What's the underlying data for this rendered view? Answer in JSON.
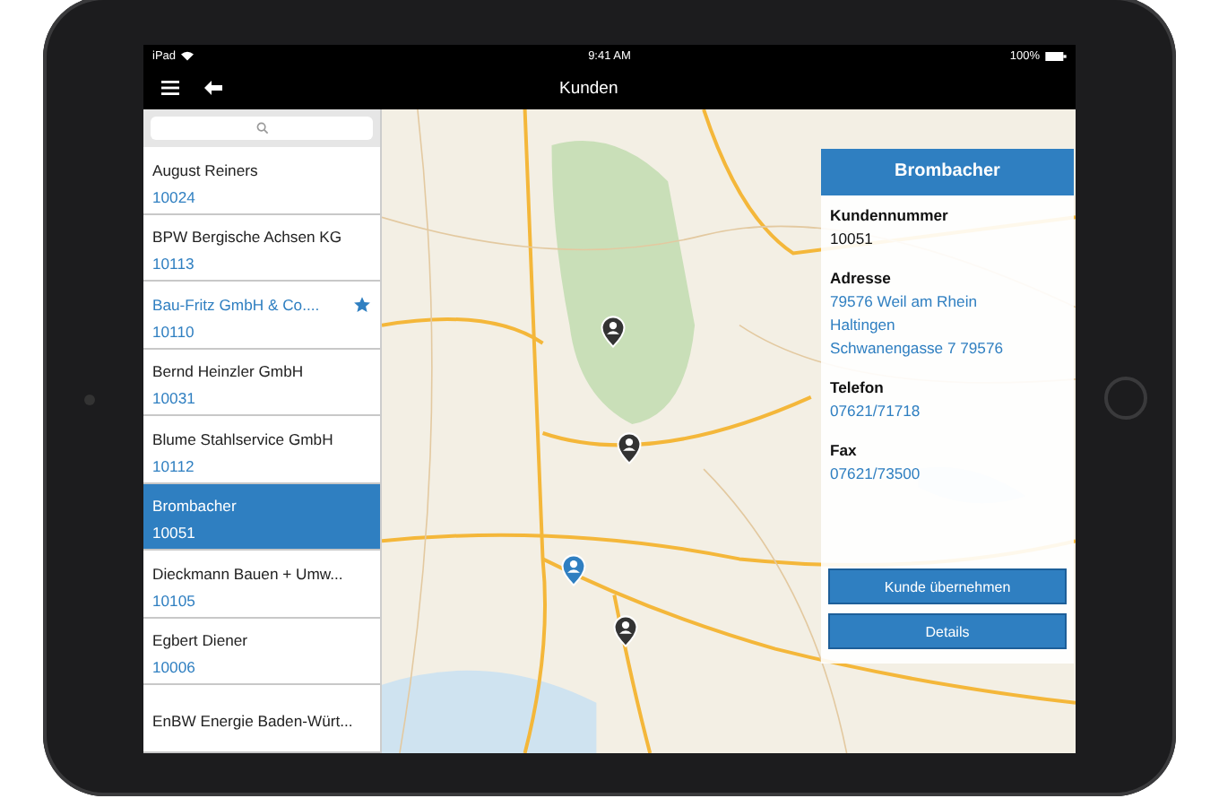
{
  "status_bar": {
    "carrier": "iPad",
    "time": "9:41 AM",
    "battery": "100%"
  },
  "nav_bar": {
    "title": "Kunden"
  },
  "customers": [
    {
      "name": "August Reiners",
      "number": "10024",
      "favorite": false,
      "selected": false
    },
    {
      "name": "BPW Bergische Achsen KG",
      "number": "10113",
      "favorite": false,
      "selected": false
    },
    {
      "name": "Bau-Fritz GmbH & Co....",
      "number": "10110",
      "favorite": true,
      "selected": false
    },
    {
      "name": "Bernd Heinzler GmbH",
      "number": "10031",
      "favorite": false,
      "selected": false
    },
    {
      "name": "Blume Stahlservice GmbH",
      "number": "10112",
      "favorite": false,
      "selected": false
    },
    {
      "name": "Brombacher",
      "number": "10051",
      "favorite": false,
      "selected": true
    },
    {
      "name": "Dieckmann Bauen + Umw...",
      "number": "10105",
      "favorite": false,
      "selected": false
    },
    {
      "name": "Egbert Diener",
      "number": "10006",
      "favorite": false,
      "selected": false
    },
    {
      "name": "EnBW Energie Baden-Würt...",
      "favorite": false,
      "selected": false
    }
  ],
  "detail": {
    "title": "Brombacher",
    "fields": [
      {
        "label": "Kundennummer",
        "lines": [
          "10051"
        ],
        "kind": "plain"
      },
      {
        "label": "Adresse",
        "lines": [
          "79576 Weil am Rhein",
          "Haltingen",
          "Schwanengasse 7 79576"
        ],
        "kind": "link"
      },
      {
        "label": "Telefon",
        "lines": [
          "07621/71718"
        ],
        "kind": "link"
      },
      {
        "label": "Fax",
        "lines": [
          "07621/73500"
        ],
        "kind": "link"
      }
    ],
    "buttons": [
      "Kunde übernehmen",
      "Details"
    ]
  }
}
